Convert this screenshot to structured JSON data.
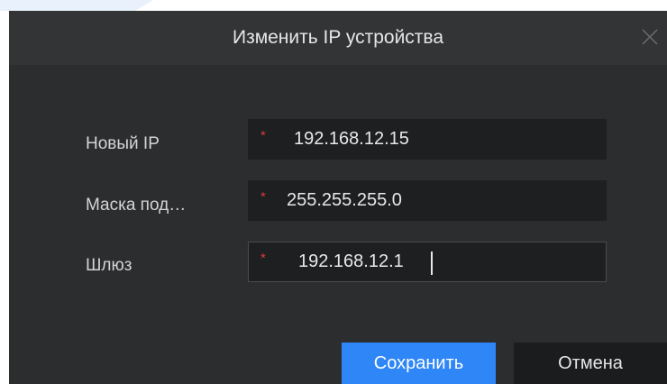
{
  "dialog": {
    "title": "Изменить IP устройства",
    "close_icon": "close-icon"
  },
  "form": {
    "fields": [
      {
        "label": "Новый IP",
        "required_mark": "*",
        "value": "192.168.12.15"
      },
      {
        "label": "Маска под…",
        "required_mark": "*",
        "value": "255.255.255.0"
      },
      {
        "label": "Шлюз",
        "required_mark": "*",
        "value": "192.168.12.1"
      }
    ]
  },
  "buttons": {
    "save_label": "Сохранить",
    "cancel_label": "Отмена"
  },
  "colors": {
    "accent": "#2f86f6",
    "dialog_bg": "#2c2d2f",
    "input_bg": "#1e1f21",
    "required": "#d93a3a"
  }
}
